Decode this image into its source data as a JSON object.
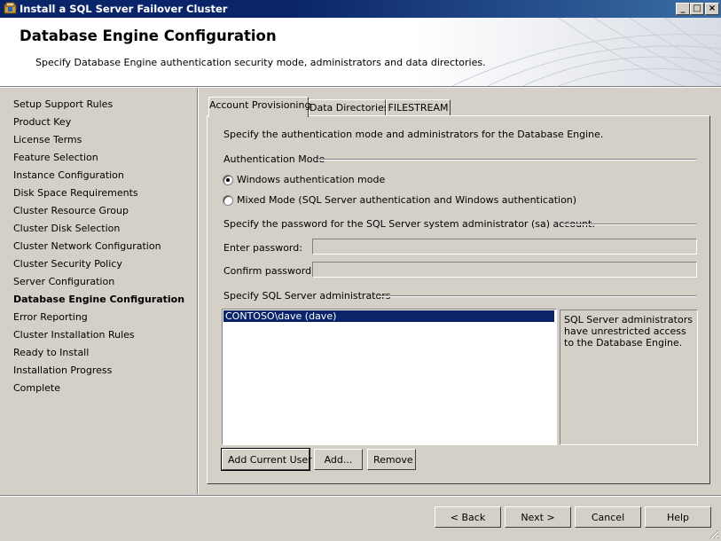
{
  "window": {
    "title": "Install a SQL Server Failover Cluster"
  },
  "header": {
    "title": "Database Engine Configuration",
    "description": "Specify Database Engine authentication security mode, administrators and data directories."
  },
  "nav": {
    "items": [
      "Setup Support Rules",
      "Product Key",
      "License Terms",
      "Feature Selection",
      "Instance Configuration",
      "Disk Space Requirements",
      "Cluster Resource Group",
      "Cluster Disk Selection",
      "Cluster Network Configuration",
      "Cluster Security Policy",
      "Server Configuration",
      "Database Engine Configuration",
      "Error Reporting",
      "Cluster Installation Rules",
      "Ready to Install",
      "Installation Progress",
      "Complete"
    ],
    "active_index": 11
  },
  "tabs": [
    "Account Provisioning",
    "Data Directories",
    "FILESTREAM"
  ],
  "panel": {
    "intro": "Specify the authentication mode and administrators for the Database Engine.",
    "auth_mode_label": "Authentication Mode",
    "radio_windows": "Windows authentication mode",
    "radio_mixed": "Mixed Mode (SQL Server authentication and Windows authentication)",
    "selected_mode": "windows",
    "sa_password_label": "Specify the password for the SQL Server system administrator (sa) account.",
    "enter_password_label": "Enter password:",
    "confirm_password_label": "Confirm password:",
    "admins_label": "Specify SQL Server administrators",
    "admins": [
      "CONTOSO\\dave (dave)"
    ],
    "admins_info": "SQL Server administrators have unrestricted access to the Database Engine.",
    "add_current_user": "Add Current User",
    "add": "Add...",
    "remove": "Remove"
  },
  "footer": {
    "back": "< Back",
    "next": "Next >",
    "cancel": "Cancel",
    "help": "Help"
  },
  "colors": {
    "titlebar": "#0a246a",
    "selection": "#0a246a",
    "face": "#d4d0c8"
  }
}
